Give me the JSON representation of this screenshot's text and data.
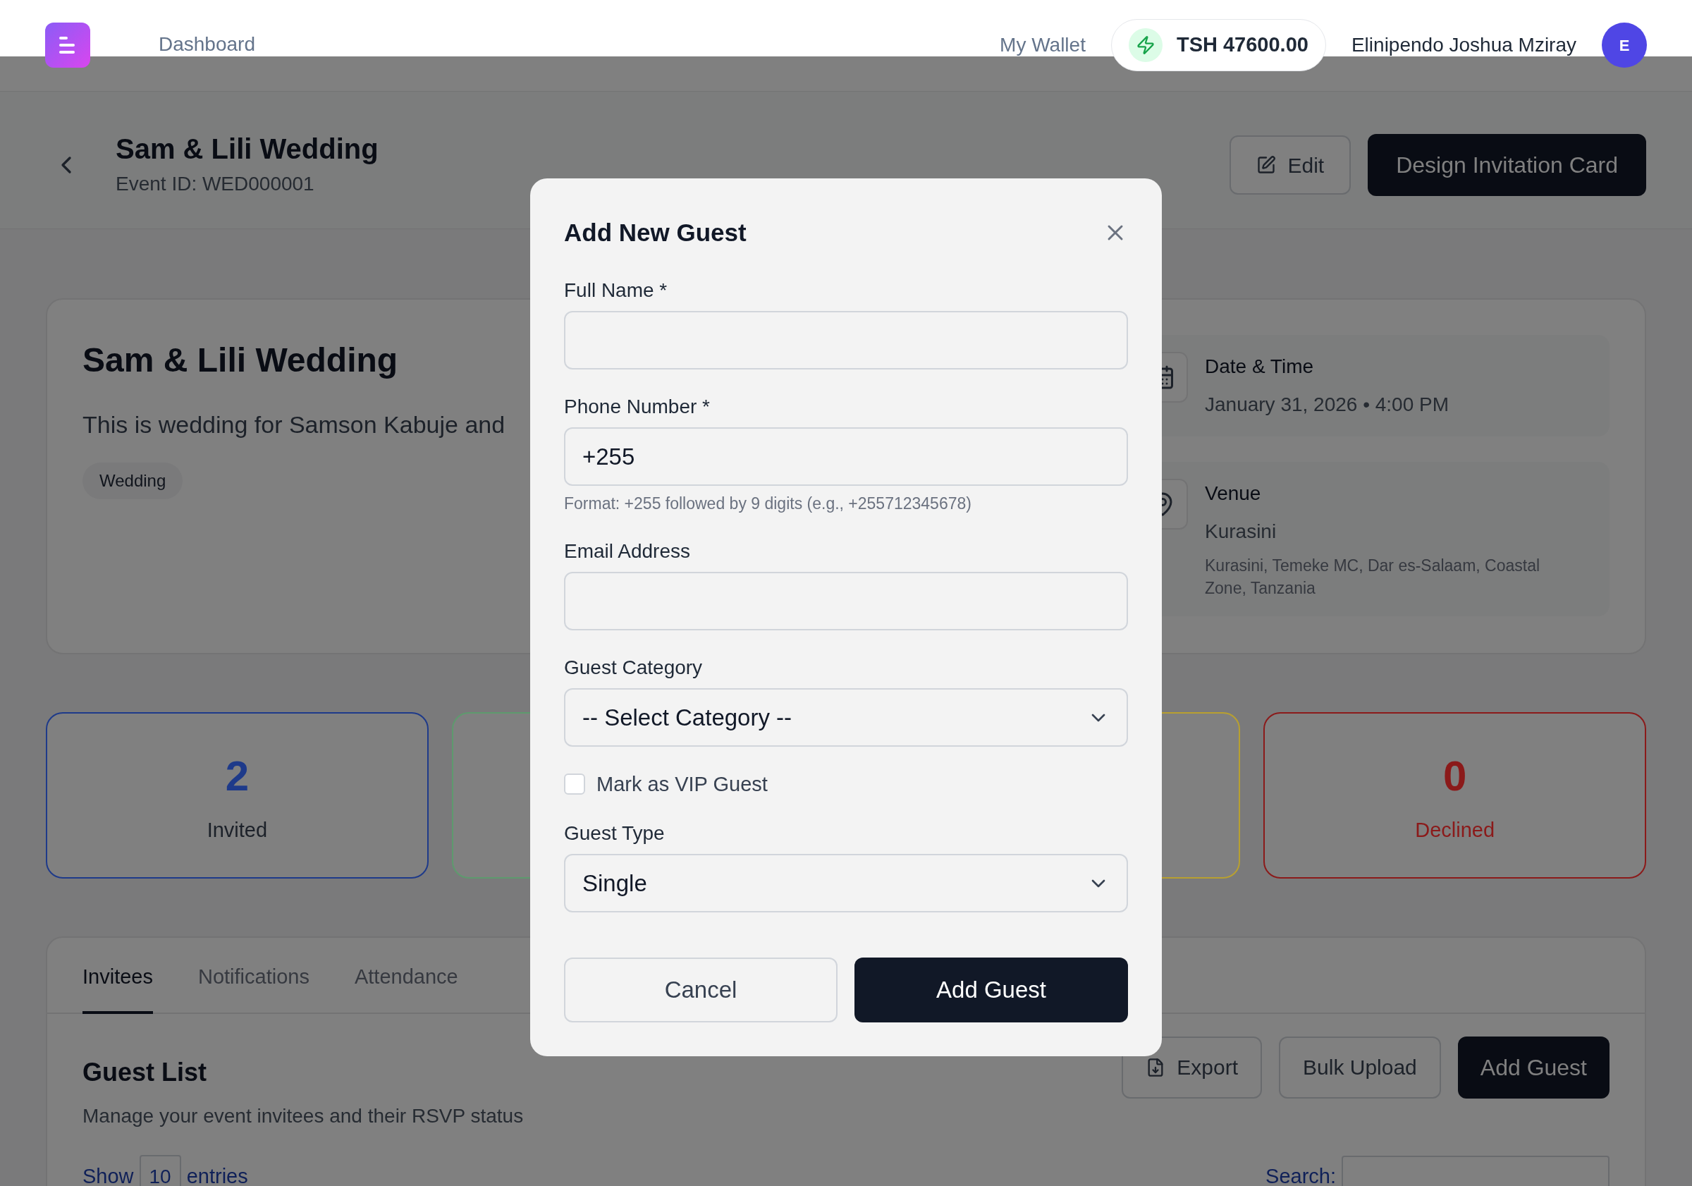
{
  "topbar": {
    "nav_link": "Dashboard",
    "wallet_label": "My Wallet",
    "balance": "TSH 47600.00",
    "user_name": "Elinipendo Joshua Mziray",
    "avatar_initial": "E"
  },
  "header": {
    "title": "Sam & Lili Wedding",
    "event_id": "Event ID: WED000001",
    "buttons": [
      {
        "label": "Edit",
        "kind": "edit"
      },
      {
        "label": "Design Invitation Card",
        "kind": "primary"
      }
    ]
  },
  "event_card": {
    "title": "Sam & Lili Wedding",
    "description": "This is wedding for Samson Kabuje and",
    "tag": "Wedding",
    "details": [
      {
        "kind": "date",
        "label": "Date & Time",
        "value": "January 31, 2026 • 4:00 PM"
      },
      {
        "kind": "venue",
        "label": "Venue",
        "value": "Kurasini",
        "address": "Kurasini, Temeke MC, Dar es-Salaam, Coastal Zone, Tanzania"
      }
    ]
  },
  "stats": [
    {
      "value": "2",
      "label": "Invited",
      "color": "#1e3a8a",
      "label_colored": false
    },
    {
      "color": "#5e9a6e"
    },
    {
      "color": "#b8a030"
    },
    {
      "value": "0",
      "label": "Declined",
      "color": "#8b1a1a",
      "label_colored": true
    }
  ],
  "tabs": [
    {
      "label": "Invitees",
      "selected": true
    },
    {
      "label": "Notifications",
      "selected": false
    },
    {
      "label": "Attendance",
      "selected": false
    }
  ],
  "guest_list": {
    "title": "Guest List",
    "subtitle": "Manage your event invitees and their RSVP status",
    "actions": [
      {
        "label": "Export",
        "kind": "export"
      },
      {
        "label": "Bulk Upload",
        "kind": "outline"
      },
      {
        "label": "Add Guest",
        "kind": "primary"
      }
    ],
    "show_label": "Show",
    "page_size": "10",
    "entries_label": "entries",
    "search_label": "Search:"
  },
  "modal": {
    "title": "Add New Guest",
    "fields": [
      {
        "kind": "text",
        "label": "Full Name *"
      },
      {
        "kind": "text",
        "label": "Phone Number *",
        "value": "+255",
        "hint": "Format: +255 followed by 9 digits (e.g., +255712345678)"
      },
      {
        "kind": "text",
        "label": "Email Address"
      },
      {
        "kind": "select",
        "label": "Guest Category",
        "value": "-- Select Category --"
      },
      {
        "kind": "checkbox",
        "label": "Mark as VIP Guest",
        "checked": false
      },
      {
        "kind": "select",
        "label": "Guest Type",
        "value": "Single"
      }
    ],
    "buttons": [
      {
        "label": "Cancel",
        "kind": "outline"
      },
      {
        "label": "Add Guest",
        "kind": "primary"
      }
    ]
  }
}
